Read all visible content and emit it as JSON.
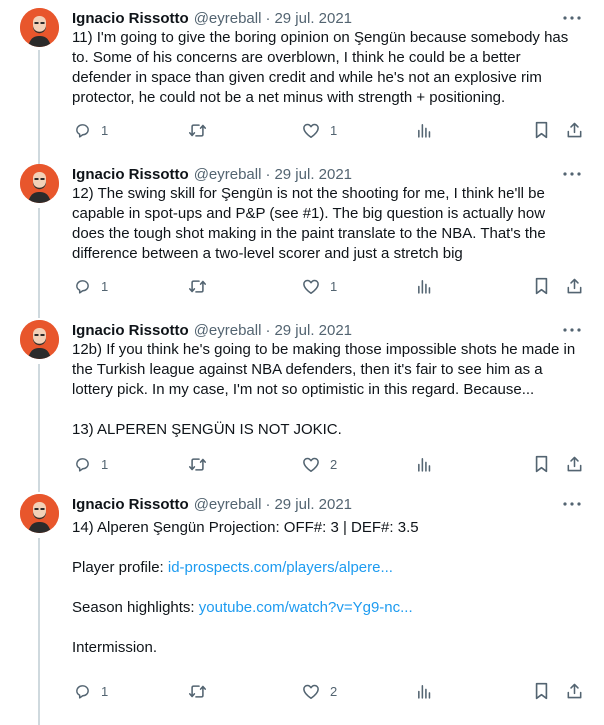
{
  "thread": {
    "tweets": [
      {
        "author_name": "Ignacio Rissotto",
        "handle": "@eyreball",
        "separator": "·",
        "date": "29 jul. 2021",
        "lines": [
          "11) I'm going to give the boring opinion on Şengün because somebody has",
          "to. Some of his concerns are overblown, I think he could be a better",
          "defender in space than given credit and while he's not an explosive rim",
          "protector, he could not be a net minus with strength + positioning."
        ],
        "reply_count": "1",
        "like_count": "1"
      },
      {
        "author_name": "Ignacio Rissotto",
        "handle": "@eyreball",
        "separator": "·",
        "date": "29 jul. 2021",
        "lines": [
          "12) The swing skill for Şengün is not the shooting for me, I think he'll be",
          "capable in spot-ups and P&P (see #1). The big question is actually how",
          "does the tough shot making in the paint translate to the NBA. That's the",
          "difference between a two-level scorer and just a stretch big"
        ],
        "reply_count": "1",
        "like_count": "1"
      },
      {
        "author_name": "Ignacio Rissotto",
        "handle": "@eyreball",
        "separator": "·",
        "date": "29 jul. 2021",
        "lines": [
          "12b) If you think he's going to be making those impossible shots he made in",
          "the Turkish league against NBA defenders, then it's fair to see him as a",
          "lottery pick. In my case, I'm not so optimistic in this regard. Because...",
          "",
          "13) ALPEREN ŞENGÜN IS NOT JOKIC."
        ],
        "reply_count": "1",
        "like_count": "2"
      },
      {
        "author_name": "Ignacio Rissotto",
        "handle": "@eyreball",
        "separator": "·",
        "date": "29 jul. 2021",
        "line1": "14) Alperen Şengün Projection: OFF#: 3 | DEF#: 3.5",
        "profile_label": "Player profile: ",
        "profile_link": "id-prospects.com/players/alpere...",
        "highlights_label": "Season highlights: ",
        "highlights_link": "youtube.com/watch?v=Yg9-nc...",
        "closing": "Intermission.",
        "reply_count": "1",
        "like_count": "2"
      }
    ]
  },
  "icons": {
    "reply": "speech-bubble-icon",
    "retweet": "retweet-arrows-icon",
    "like": "heart-icon",
    "views": "bar-chart-icon",
    "bookmark": "bookmark-icon",
    "share": "share-upload-icon",
    "more": "more-dots-icon"
  },
  "colors": {
    "text": "#0f1419",
    "secondary": "#536471",
    "link": "#1d9bf0",
    "thread_line": "#cfd9de",
    "avatar_bg": "#e8562c"
  }
}
